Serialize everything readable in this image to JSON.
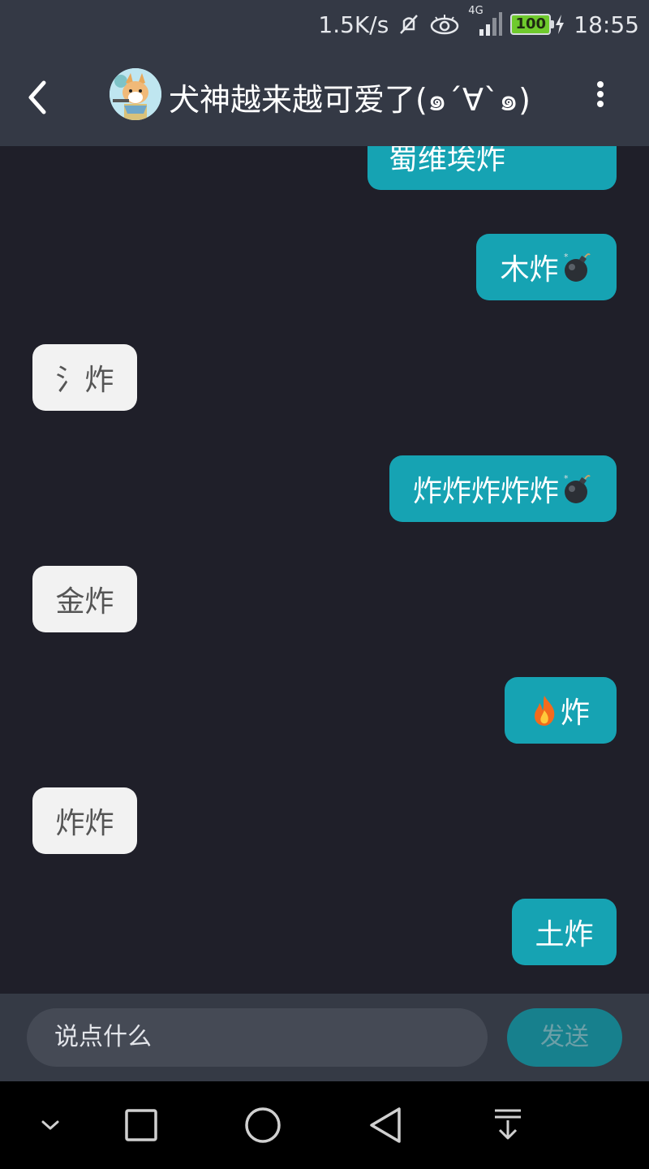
{
  "status_bar": {
    "net_speed": "1.5K/s",
    "network": "4G",
    "battery": "100",
    "time": "18:55"
  },
  "header": {
    "title": "犬神越来越可爱了(๑´∀`๑)",
    "back_icon": "chevron-left-icon",
    "menu_icon": "more-vertical-icon"
  },
  "messages": [
    {
      "side": "sent",
      "text": "蜀维埃炸"
    },
    {
      "side": "sent",
      "text": "木炸",
      "emoji": "bomb"
    },
    {
      "side": "recv",
      "text": "氵炸"
    },
    {
      "side": "sent",
      "text": "炸炸炸炸炸",
      "emoji": "bomb"
    },
    {
      "side": "recv",
      "text": "金炸"
    },
    {
      "side": "sent",
      "text": "炸",
      "emoji_before": "fire"
    },
    {
      "side": "recv",
      "text": "炸炸"
    },
    {
      "side": "sent",
      "text": "土炸"
    }
  ],
  "composer": {
    "placeholder": "说点什么",
    "send_label": "发送"
  },
  "colors": {
    "header_bg": "#343945",
    "chat_bg": "#1f1f29",
    "sent_bubble": "#16a3b3",
    "recv_bubble": "#f2f2f2",
    "send_button": "#17808d"
  }
}
